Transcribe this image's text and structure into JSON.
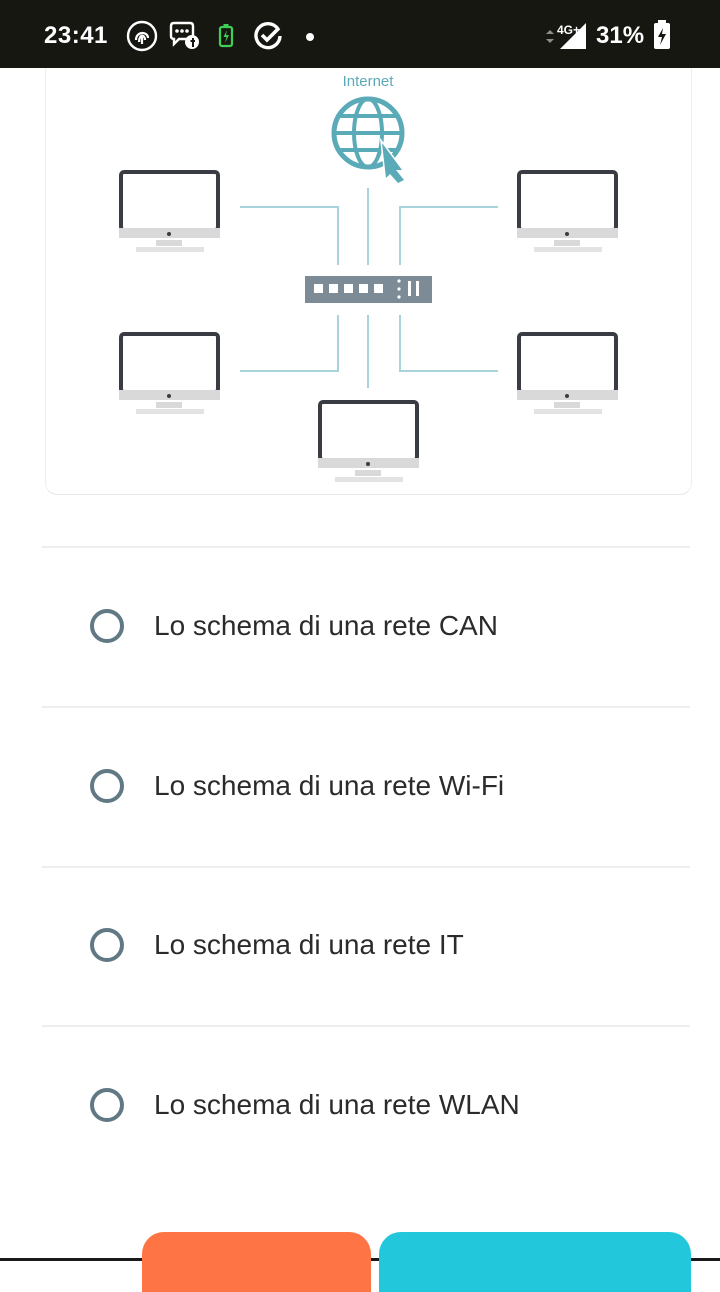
{
  "status_bar": {
    "time": "23:41",
    "network_label": "4G+",
    "battery_percent": "31%",
    "icons": [
      "fingerprint-icon",
      "messenger-icon",
      "battery-saver-icon",
      "check-circle-icon",
      "dot-icon",
      "network-arrows-icon",
      "signal-icon",
      "battery-charging-icon"
    ]
  },
  "diagram": {
    "internet_label": "Internet",
    "icons": [
      "globe-cursor-icon",
      "network-switch-icon",
      "computer-icon"
    ]
  },
  "options": [
    {
      "label": "Lo schema di una rete CAN",
      "selected": false
    },
    {
      "label": "Lo schema di una rete Wi-Fi",
      "selected": false
    },
    {
      "label": "Lo schema di una rete IT",
      "selected": false
    },
    {
      "label": "Lo schema di una rete WLAN",
      "selected": false
    }
  ],
  "colors": {
    "status_bar_bg": "#171712",
    "radio_border": "#607985",
    "left_button": "#ff7444",
    "right_button": "#22c7dc",
    "diagram_accent": "#5aaab7"
  }
}
